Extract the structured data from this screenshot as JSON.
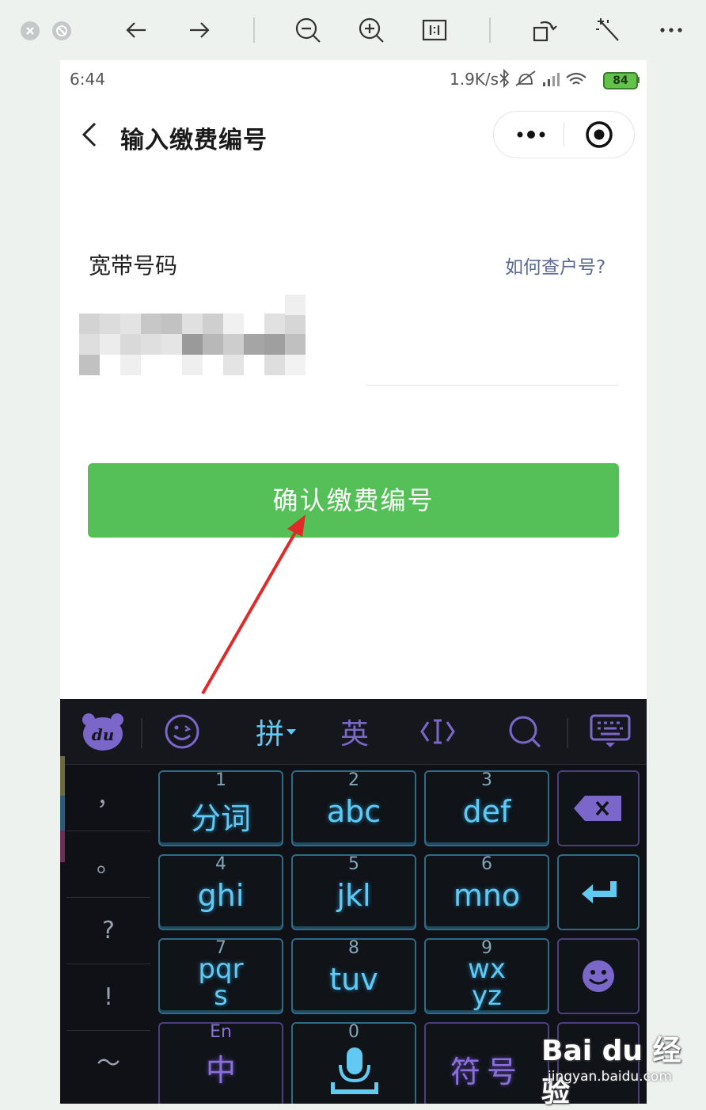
{
  "viewer": {
    "tools": [
      "close",
      "stop",
      "back",
      "forward",
      "zoom-out",
      "zoom-in",
      "actual-size",
      "rotate",
      "magic",
      "more"
    ]
  },
  "status": {
    "time": "6:44",
    "speed": "1.9K/s",
    "battery": "84"
  },
  "nav": {
    "title": "输入缴费编号"
  },
  "form": {
    "label": "宽带号码",
    "help_link": "如何查户号?",
    "value_obscured": true
  },
  "confirm_button": "确认缴费编号",
  "keyboard": {
    "toolbar": {
      "pinyin": "拼",
      "english": "英"
    },
    "left_column": [
      "，",
      "。",
      "?",
      "!",
      "～"
    ],
    "keys": [
      {
        "num": "1",
        "label": "分词"
      },
      {
        "num": "2",
        "label": "abc"
      },
      {
        "num": "3",
        "label": "def"
      },
      {
        "num": "4",
        "label": "ghi"
      },
      {
        "num": "5",
        "label": "jkl"
      },
      {
        "num": "6",
        "label": "mno"
      },
      {
        "num": "7",
        "label": "pqrs"
      },
      {
        "num": "8",
        "label": "tuv"
      },
      {
        "num": "9",
        "label": "wxyz"
      }
    ],
    "bottom": {
      "en": "En",
      "zh": "中",
      "zero": "0",
      "symbol": "符号"
    },
    "colors": {
      "accent": "#62c9f3",
      "purple": "#8a70d8",
      "bg": "#0f1116"
    }
  },
  "watermark": {
    "logo": "Bai du 经验",
    "sub": "jingyan.baidu.com"
  },
  "colors": {
    "button_green": "#55c057",
    "arrow_red": "#e02a2a"
  }
}
